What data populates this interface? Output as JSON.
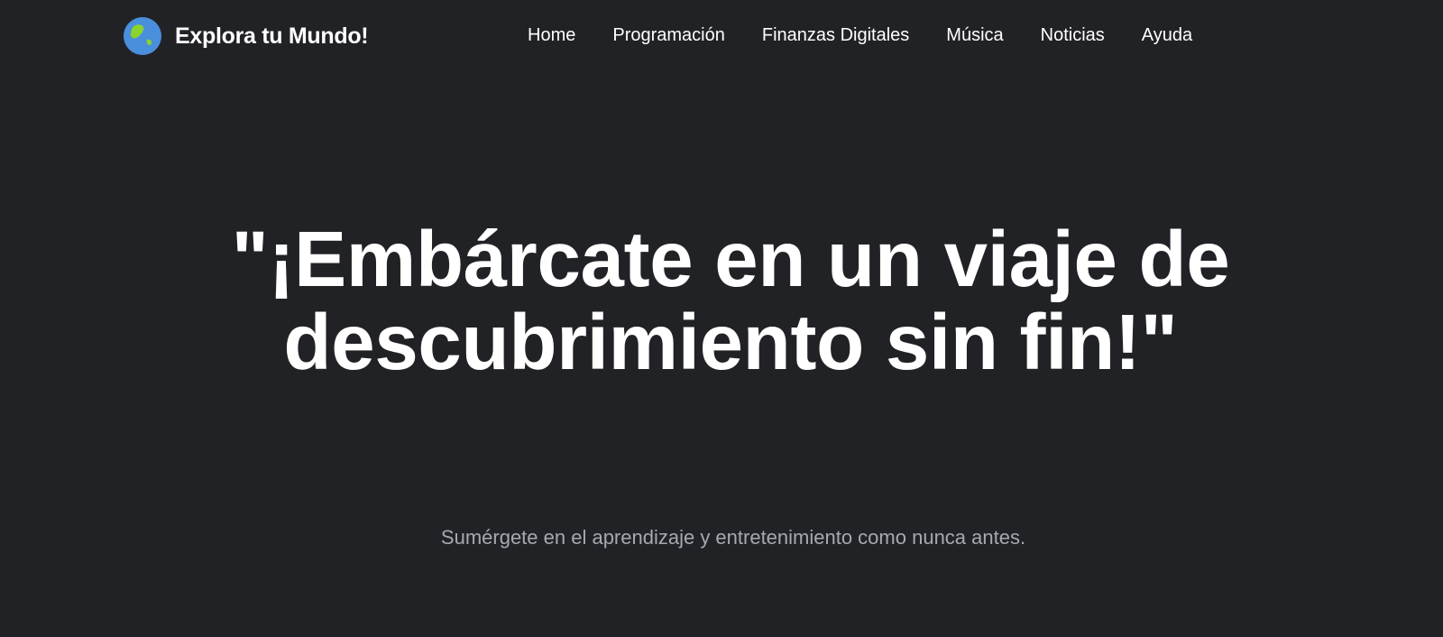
{
  "brand": {
    "name": "Explora tu Mundo!",
    "logo_icon": "globe-icon",
    "logo_colors": {
      "ocean": "#4a8fdc",
      "land": "#8bd32d"
    }
  },
  "nav": {
    "items": [
      {
        "label": "Home"
      },
      {
        "label": "Programación"
      },
      {
        "label": "Finanzas Digitales"
      },
      {
        "label": "Música"
      },
      {
        "label": "Noticias"
      },
      {
        "label": "Ayuda"
      }
    ]
  },
  "hero": {
    "title": "\"¡Embárcate en un viaje de descubrimiento sin fin!\"",
    "subtitle": "Sumérgete en el aprendizaje y entretenimiento como nunca antes."
  },
  "colors": {
    "background": "#212226",
    "text": "#ffffff",
    "muted_text": "#a7a9ae"
  }
}
